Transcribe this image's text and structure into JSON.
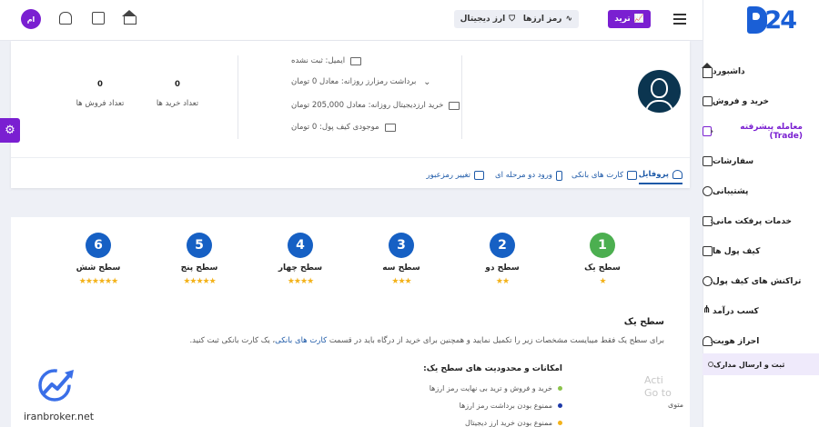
{
  "sidebar": {
    "brand": "PF24",
    "items": [
      {
        "label": "داشبورد",
        "icon": "home-icon",
        "has_submenu": false
      },
      {
        "label": "خرید و فروش",
        "icon": "exchange-icon",
        "has_submenu": false
      },
      {
        "label": "معامله پیشرفته (Trade)",
        "icon": "trade-icon",
        "has_submenu": true,
        "active": true
      },
      {
        "label": "سفارشات",
        "icon": "orders-icon",
        "has_submenu": false
      },
      {
        "label": "پشتیبانی",
        "icon": "support-icon",
        "has_submenu": false
      },
      {
        "label": "خدمات پرفکت مانی",
        "icon": "perfect-money-icon",
        "has_submenu": true
      },
      {
        "label": "کیف پول ها",
        "icon": "wallet-icon",
        "has_submenu": false
      },
      {
        "label": "تراکنش های کیف پول",
        "icon": "transactions-icon",
        "has_submenu": true
      },
      {
        "label": "کسب درآمد",
        "icon": "earn-icon",
        "has_submenu": false
      },
      {
        "label": "احراز هویت",
        "icon": "identity-icon",
        "has_submenu": true
      }
    ],
    "sub_item": "ثبت و ارسال مدارک",
    "caret": "‹"
  },
  "topbar": {
    "trade_label": "ترید",
    "crypto_label": "رمز ارزها",
    "digital_label": "ارز دیجیتال",
    "avatar_initials": "ام"
  },
  "profile": {
    "email": "ایمیل: ثبت نشده",
    "daily_withdraw": "برداشت رمزارز روزانه: معادل 0 تومان",
    "daily_buy": "خرید ارزدیجیتال روزانه: معادل 205,000 تومان",
    "wallet_balance": "موجودی کیف پول: 0 تومان",
    "purchases_count": "0",
    "purchases_label": "تعداد خرید ها",
    "sales_count": "0",
    "sales_label": "تعداد فروش ها",
    "tabs": [
      {
        "label": "پروفایل",
        "active": true
      },
      {
        "label": "کارت های بانکی"
      },
      {
        "label": "ورود دو مرحله ای"
      },
      {
        "label": "تغییر رمزعبور"
      }
    ]
  },
  "levels": [
    {
      "number": "1",
      "title": "سطح یک",
      "stars": "★",
      "done": true
    },
    {
      "number": "2",
      "title": "سطح دو",
      "stars": "★★"
    },
    {
      "number": "3",
      "title": "سطح سه",
      "stars": "★★★"
    },
    {
      "number": "4",
      "title": "سطح چهار",
      "stars": "★★★★"
    },
    {
      "number": "5",
      "title": "سطح پنج",
      "stars": "★★★★★"
    },
    {
      "number": "6",
      "title": "سطح شش",
      "stars": "★★★★★★"
    }
  ],
  "level_detail": {
    "title": "سطح یک",
    "desc_before": "برای سطح یک فقط میبایست مشخصات زیر را تکمیل نمایید و همچنین برای خرید از درگاه باید در قسمت",
    "desc_link": "کارت های بانکی",
    "desc_after": "، یک کارت بانکی ثبت کنید.",
    "features_title": "امکانات و محدودیت های سطح یک:",
    "features": [
      "خرید و فروش و ترید بی نهایت رمز ارزها",
      "ممنوع بودن برداشت رمز ارزها",
      "ممنوع بودن خرید ارز دیجیتال"
    ],
    "feature_colors": [
      "#8bc34a",
      "#1e3aa8",
      "#f3b21a"
    ]
  },
  "overlay": {
    "watermark": "iranbroker.net",
    "activate_line1": "Acti",
    "activate_line2": "Go to",
    "cut_text": "متوی"
  }
}
